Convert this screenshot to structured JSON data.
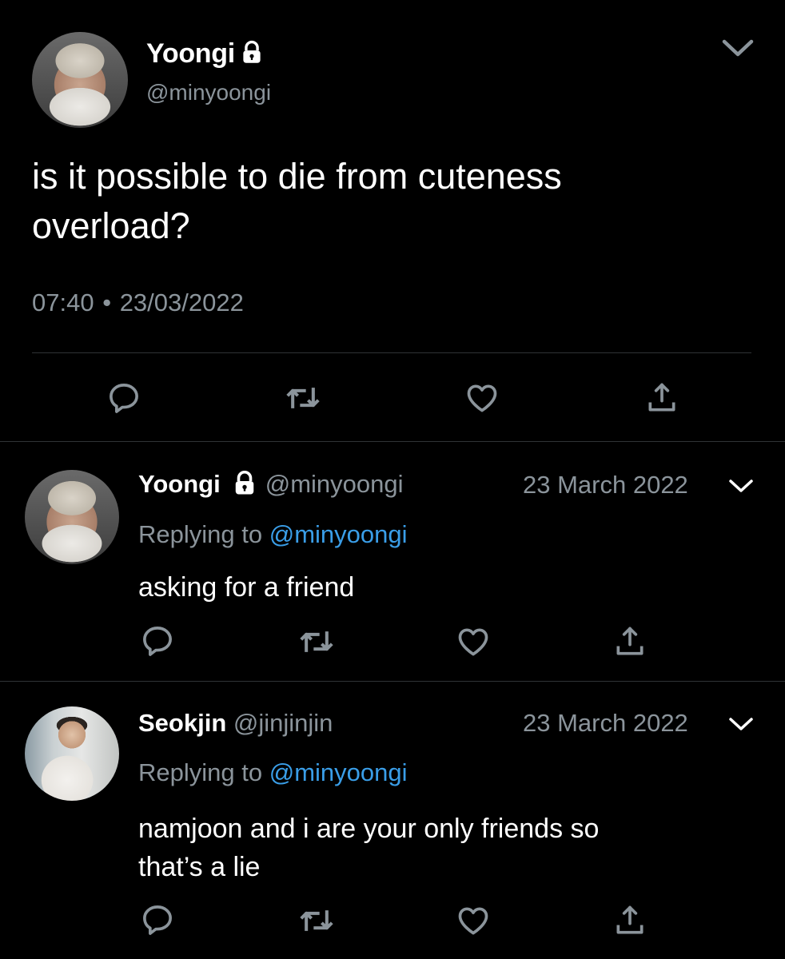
{
  "main_tweet": {
    "display_name": "Yoongi",
    "handle": "@minyoongi",
    "text_line1": "is it possible to die from cuteness",
    "text_line2": "overload?",
    "time": "07:40",
    "separator": "•",
    "date": "23/03/2022",
    "avatar_icon": "yoongi-avatar",
    "lock_icon": "lock-icon"
  },
  "replies": [
    {
      "display_name": "Yoongi",
      "handle": "@minyoongi",
      "date": "23 March 2022",
      "replying_label": "Replying to",
      "replying_to": "@minyoongi",
      "text_line1": "asking for a friend",
      "text_line2": ""
    },
    {
      "display_name": "Seokjin",
      "handle": "@jinjinjin",
      "date": "23 March 2022",
      "replying_label": "Replying to",
      "replying_to": "@minyoongi",
      "text_line1": "namjoon and i are your only friends so",
      "text_line2": "that’s a lie"
    }
  ],
  "colors": {
    "background": "#000000",
    "text": "#ffffff",
    "secondary": "#8b949b",
    "link": "#3a9ee8",
    "divider": "#2f3336"
  },
  "actions": [
    "reply-icon",
    "retweet-icon",
    "like-icon",
    "share-icon"
  ]
}
